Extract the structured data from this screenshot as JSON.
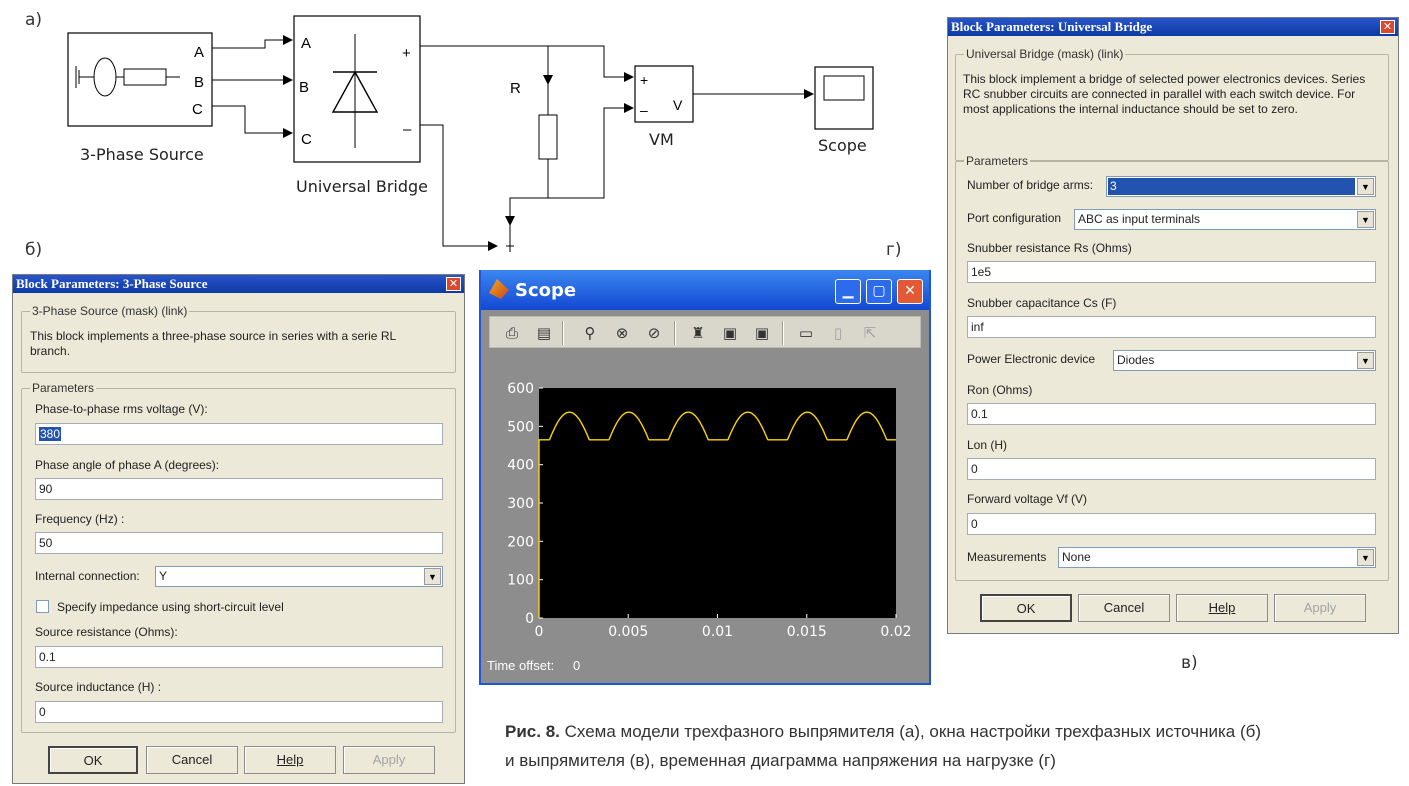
{
  "panel_labels": {
    "a": "а)",
    "b": "б)",
    "v": "в)",
    "g": "г)"
  },
  "diagram": {
    "source_ports": [
      "A",
      "B",
      "C"
    ],
    "source_label": "3-Phase Source",
    "bridge_ports": [
      "A",
      "B",
      "C"
    ],
    "bridge_plus": "+",
    "bridge_minus": "–",
    "bridge_label": "Universal Bridge",
    "resistor_label": "R",
    "vm_plus": "+",
    "vm_minus": "–",
    "vm_out": "V",
    "vm_label": "VM",
    "scope_label": "Scope"
  },
  "source_dialog": {
    "title": "Block Parameters: 3-Phase Source",
    "close_glyph": "✕",
    "mask_title": "3-Phase Source (mask) (link)",
    "description": "This block implements a three-phase source in series with a serie RL branch.",
    "params_title": "Parameters",
    "voltage_label": "Phase-to-phase rms voltage (V):",
    "voltage_value": "380",
    "angle_label": "Phase angle of phase A (degrees):",
    "angle_value": "90",
    "freq_label": "Frequency (Hz) :",
    "freq_value": "50",
    "conn_label": "Internal connection:",
    "conn_value": "Y",
    "impedance_label": "Specify impedance using short-circuit level",
    "res_label": "Source resistance (Ohms):",
    "res_value": "0.1",
    "ind_label": "Source inductance (H) :",
    "ind_value": "0",
    "buttons": {
      "ok": "OK",
      "cancel": "Cancel",
      "help": "Help",
      "apply": "Apply"
    }
  },
  "bridge_dialog": {
    "title": "Block Parameters: Universal Bridge",
    "close_glyph": "✕",
    "mask_title": "Universal Bridge (mask) (link)",
    "description": "This block implement a bridge of selected power electronics devices. Series RC snubber circuits are connected in parallel with each switch device.  For most applications the internal inductance should be set to zero.",
    "params_title": "Parameters",
    "arms_label": "Number of bridge arms:",
    "arms_value": "3",
    "port_label": "Port configuration",
    "port_value": "ABC as input terminals",
    "rs_label": "Snubber resistance Rs (Ohms)",
    "rs_value": "1e5",
    "cs_label": "Snubber capacitance Cs (F)",
    "cs_value": "inf",
    "device_label": "Power Electronic device",
    "device_value": "Diodes",
    "ron_label": "Ron (Ohms)",
    "ron_value": "0.1",
    "lon_label": "Lon (H)",
    "lon_value": "0",
    "vf_label": "Forward voltage Vf (V)",
    "vf_value": "0",
    "meas_label": "Measurements",
    "meas_value": "None",
    "buttons": {
      "ok": "OK",
      "cancel": "Cancel",
      "help": "Help",
      "apply": "Apply"
    }
  },
  "scope_window": {
    "title": "Scope",
    "time_offset_label": "Time offset:",
    "time_offset_value": "0",
    "toolbar_icons": [
      "print-icon",
      "parameters-icon",
      "zoom-icon",
      "zoom-x-icon",
      "zoom-y-icon",
      "autoscale-icon",
      "save-axes-icon",
      "restore-axes-icon",
      "floating-scope-icon",
      "lock-axes-icon",
      "signal-selector-icon"
    ]
  },
  "chart_data": {
    "type": "line",
    "title": "",
    "xlabel": "",
    "ylabel": "",
    "xlim": [
      0,
      0.02
    ],
    "ylim": [
      0,
      600
    ],
    "xticks": [
      "0",
      "0.005",
      "0.01",
      "0.015",
      "0.02"
    ],
    "yticks": [
      "0",
      "100",
      "200",
      "300",
      "400",
      "500",
      "600"
    ],
    "grid": false,
    "background": "#000000",
    "line_color": "#ffd400",
    "series": [
      {
        "name": "",
        "ripple_period_s": 0.003333,
        "y_peak": 537,
        "y_valley": 465,
        "start_value": 0,
        "x": [
          0,
          2e-05,
          0.0004,
          0.0017,
          0.0034,
          0.005,
          0.0067,
          0.0084,
          0.01,
          0.0117,
          0.0134,
          0.015,
          0.0167,
          0.0184,
          0.02
        ],
        "y": [
          0,
          468,
          480,
          537,
          465,
          537,
          465,
          537,
          465,
          537,
          465,
          537,
          465,
          537,
          465
        ]
      }
    ]
  },
  "caption": {
    "bold": "Рис. 8.",
    "line1": "Схема модели трехфазного выпрямителя (а), окна настройки трехфазных источника (б)",
    "line2": "и выпрямителя (в), временная диаграмма напряжения на нагрузке (г)"
  }
}
